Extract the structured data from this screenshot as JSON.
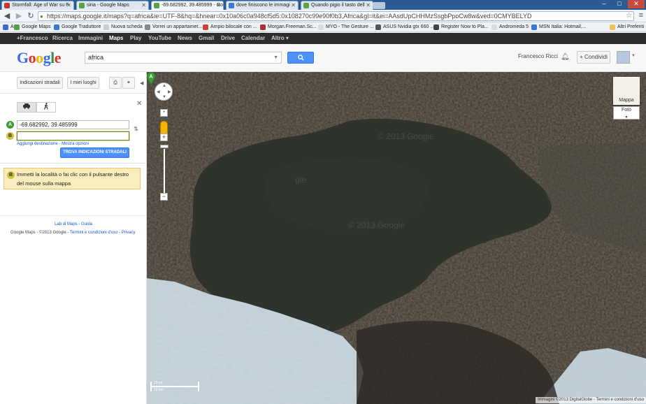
{
  "browser": {
    "tabs": [
      {
        "label": "Stormfall: Age of War su F",
        "favicon_color": "#c0392b",
        "active": false
      },
      {
        "label": "siria - Google Maps",
        "favicon_color": "#5aa04a",
        "active": false
      },
      {
        "label": "-69.682992, 39.485999 - Go",
        "favicon_color": "#5aa04a",
        "active": true
      },
      {
        "label": "dove finiscono le immagi",
        "favicon_color": "#3a78d6",
        "active": false
      },
      {
        "label": "Quando pigio il tasto dell",
        "favicon_color": "#58a641",
        "active": false
      }
    ],
    "window_controls": {
      "minimize": "–",
      "maximize": "□",
      "close": "✕"
    },
    "url": "https://maps.google.it/maps?q=africa&ie=UTF-8&hq=&hnear=0x10a06c0a948cf5d5:0x108270c99e90f0b3,Africa&gl=it&ei=AAsdUpCHHMzSsgbPpoCw8w&ved=0CMYBELYD",
    "bookmarks": [
      {
        "label": "App",
        "color": "#3c6dc4"
      },
      {
        "label": "Google Maps",
        "color": "#5aa04a"
      },
      {
        "label": "Google Traduttore",
        "color": "#3a78d6"
      },
      {
        "label": "Nuova scheda",
        "color": "#ccc"
      },
      {
        "label": "Vorrei un appartamet...",
        "color": "#888"
      },
      {
        "label": "Ampio bilocale con ...",
        "color": "#cc4433"
      },
      {
        "label": "Morgan.Freeman.Sc...",
        "color": "#a33"
      },
      {
        "label": "MYO - The Gesture ...",
        "color": "#ddd"
      },
      {
        "label": "ASUS Nvidia gtx 660 ...",
        "color": "#555"
      },
      {
        "label": "Register Now to Pla...",
        "color": "#444"
      },
      {
        "label": "Andromeda 5",
        "color": "#ddd"
      },
      {
        "label": "MSN Italia: Hotmail,...",
        "color": "#3a78d6"
      },
      {
        "label": "Altri Preferiti",
        "color": "#e9c55a"
      }
    ]
  },
  "gbar": {
    "items": [
      "+Francesco",
      "Ricerca",
      "Immagini",
      "Maps",
      "Play",
      "YouTube",
      "News",
      "Gmail",
      "Drive",
      "Calendar",
      "Altro ▾"
    ],
    "active": "Maps"
  },
  "header": {
    "logo": "Google",
    "search_value": "africa",
    "search_button_icon": "search-icon",
    "user_name": "Francesco Ricci",
    "share_label": "+ Condividi"
  },
  "panel": {
    "directions_button": "Indicazioni stradali",
    "my_places_button": "I miei luoghi",
    "field_a": "-69.682992, 39.485999",
    "field_b": "",
    "marker_a": "A",
    "marker_b": "B",
    "add_destination": "Aggiungi destinazione",
    "show_options": "Mostra opzioni",
    "links_separator": " - ",
    "find_button": "TROVA INDICAZIONI STRADALI",
    "hint_text": "Immetti la località o fai clic con il pulsante destro del mouse sulla mappa",
    "footer_lab": "Lab di Maps",
    "footer_guide": "Guida",
    "footer_copyright": "Google Maps - ©2013 Google - ",
    "footer_terms": "Termini e condizioni d'uso",
    "footer_privacy": "Privacy"
  },
  "map": {
    "watermarks": [
      "© 2013 Google",
      "gle",
      "© 2013 Google"
    ],
    "maptype_label": "Mappa",
    "earth_label": "Foto",
    "pin_label": "A",
    "scale_top": "10 mi",
    "scale_bottom": "20 km",
    "copyright": "Immagini ©2013 DigitalGlobe - Termini e condizioni d'uso"
  }
}
